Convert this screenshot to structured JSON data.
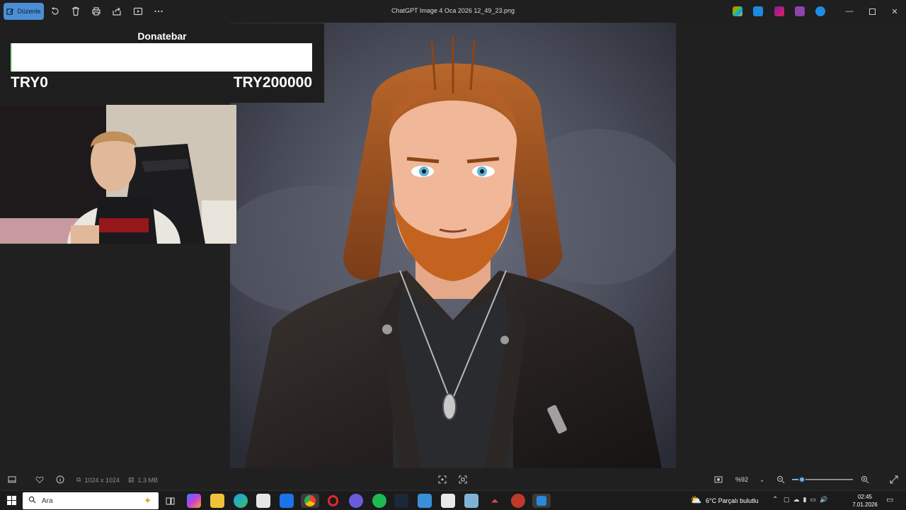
{
  "toolbar": {
    "edit_label": "Düzenle",
    "icons": [
      "rotate-icon",
      "delete-icon",
      "print-icon",
      "share-icon",
      "slideshow-icon",
      "more-icon"
    ]
  },
  "window": {
    "title": "ChatGPT Image 4 Oca 2026 12_49_23.png"
  },
  "donatebar": {
    "title": "Donatebar",
    "min_label": "TRY0",
    "max_label": "TRY200000",
    "progress": 0,
    "bar_color": "#ffffff",
    "accent_color": "#a6e3a1"
  },
  "statusbar": {
    "dimensions": "1024 x 1024",
    "file_size": "1.3 MB",
    "zoom": "%92",
    "zoom_level": 0.16
  },
  "taskbar": {
    "search_placeholder": "Ara",
    "weather": "6°C  Parçalı bulutlu",
    "time": "02:45",
    "date": "7.01.2026"
  },
  "colors": {
    "accent": "#4a8fd6",
    "background": "#202020"
  }
}
